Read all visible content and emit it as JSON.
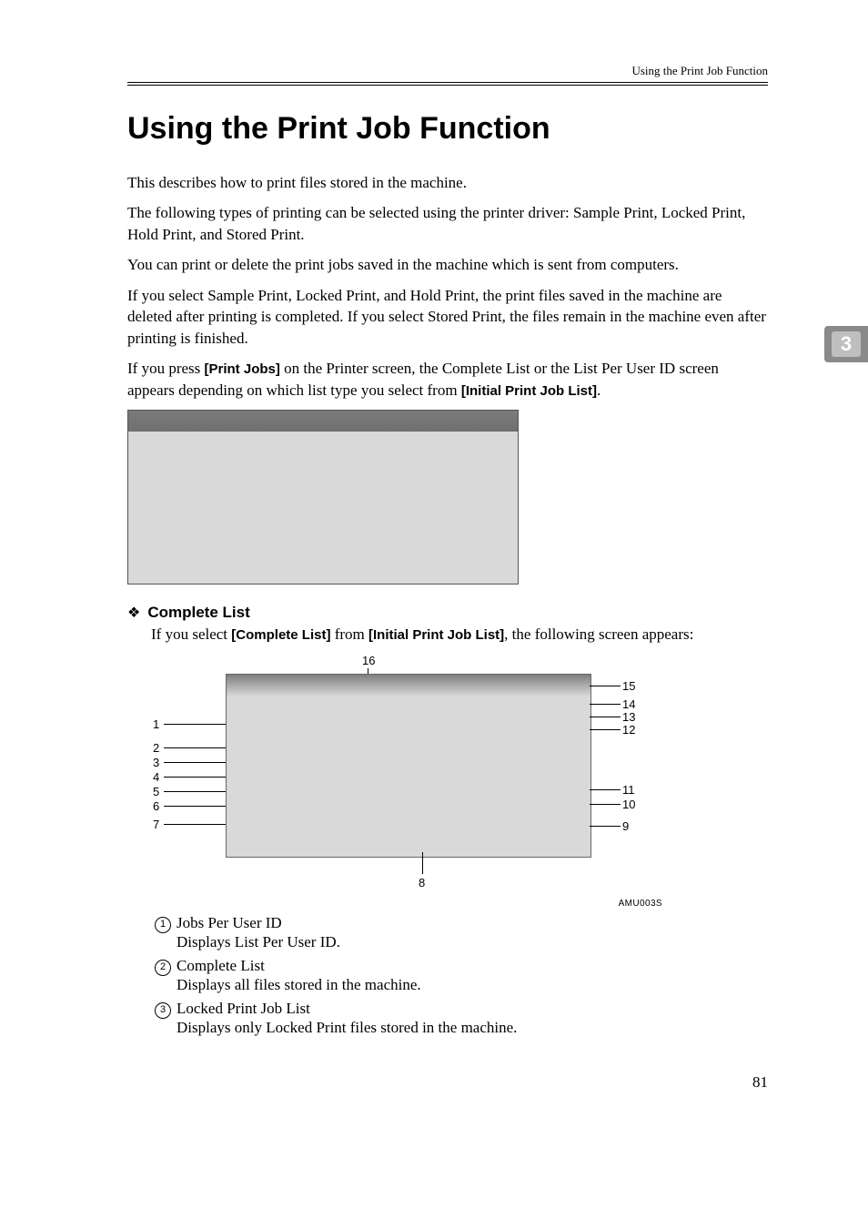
{
  "running_header": "Using the Print Job Function",
  "title": "Using the Print Job Function",
  "chapter_tab": "3",
  "paragraphs": {
    "p1": "This describes how to print files stored in the machine.",
    "p2": "The following types of printing can be selected using the printer driver: Sample Print, Locked Print, Hold Print, and Stored Print.",
    "p3": "You can print or delete the print jobs saved in the machine which is sent from computers.",
    "p4": "If you select Sample Print, Locked Print, and Hold Print, the print files saved in the machine are deleted after printing is completed. If you select Stored Print, the files remain in the machine even after printing is finished.",
    "p5_a": "If you press ",
    "p5_bold1": "[Print Jobs]",
    "p5_b": " on the Printer screen, the Complete List or the List Per User ID screen appears depending on which list type you select from ",
    "p5_bold2": "[Initial Print Job List]",
    "p5_c": "."
  },
  "sub_heading": "Complete List",
  "sub_desc_a": "If you select ",
  "sub_desc_bold1": "[Complete List]",
  "sub_desc_b": " from ",
  "sub_desc_bold2": "[Initial Print Job List]",
  "sub_desc_c": ", the following screen appears:",
  "callouts": {
    "left": [
      "1",
      "2",
      "3",
      "4",
      "5",
      "6",
      "7"
    ],
    "top": "16",
    "bottom": "8",
    "right": [
      "15",
      "14",
      "13",
      "12",
      "11",
      "10",
      "9"
    ]
  },
  "figure_id": "AMU003S",
  "definitions": [
    {
      "num": "1",
      "term": "Jobs Per User ID",
      "desc": "Displays List Per User ID."
    },
    {
      "num": "2",
      "term": "Complete List",
      "desc": "Displays all files stored in the machine."
    },
    {
      "num": "3",
      "term": "Locked Print Job List",
      "desc": "Displays only Locked Print files stored in the machine."
    }
  ],
  "page_number": "81"
}
